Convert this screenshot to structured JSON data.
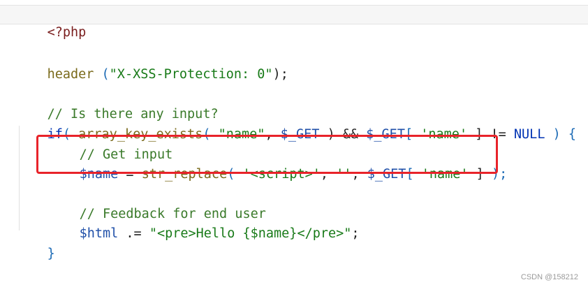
{
  "code": {
    "line_open_tag": "<?php",
    "line_header": {
      "fn": "header",
      "space": " ",
      "open": "(",
      "str": "\"X-XSS-Protection: 0\"",
      "close": ");"
    },
    "line_comment_input": "// Is there any input?",
    "line_if": {
      "kw": "if",
      "open": "( ",
      "fn": "array_key_exists",
      "open2": "( ",
      "str1": "\"name\"",
      "comma1": ", ",
      "var1": "$_GET",
      "close1": " ) && ",
      "var2": "$_GET",
      "brk_open": "[ ",
      "str2": "'name'",
      "brk_close": " ] != ",
      "null": "NULL",
      "close2": " ) {"
    },
    "line_comment_get": "// Get input",
    "line_name": {
      "var": "$name",
      "eq": " = ",
      "fn": "str_replace",
      "open": "( ",
      "str1": "'<script>'",
      "c1": ", ",
      "str2": "''",
      "c2": ", ",
      "var2": "$_GET",
      "brk_open": "[ ",
      "str3": "'name'",
      "brk_close": " ] ",
      "close": ");"
    },
    "line_comment_feedback": "// Feedback for end user",
    "line_html": {
      "var": "$html",
      "op": " .= ",
      "str": "\"<pre>Hello {$name}</pre>\"",
      "end": ";"
    },
    "line_close_brace": "}",
    "line_close_tag": "?>"
  },
  "watermark": "CSDN @158212",
  "colors": {
    "highlight_box": "#e8232a"
  }
}
